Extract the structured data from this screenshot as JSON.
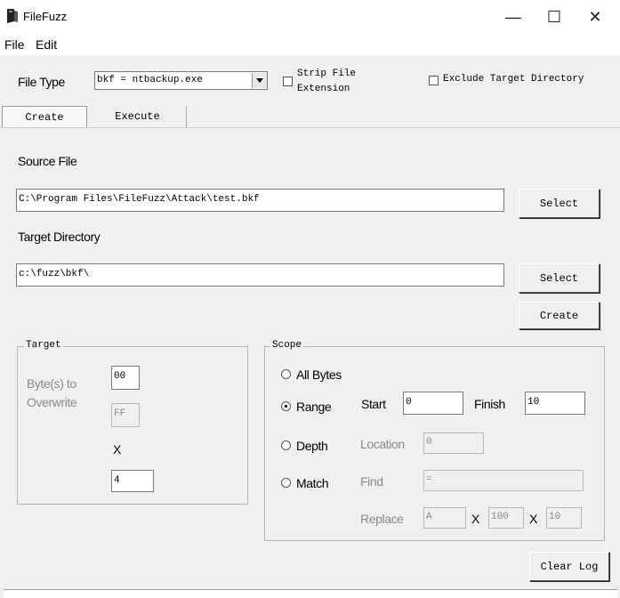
{
  "window": {
    "title": "FileFuzz",
    "minimize": "—",
    "maximize": "☐",
    "close": "✕"
  },
  "menu": {
    "file": "File",
    "edit": "Edit"
  },
  "header": {
    "file_type_label": "File Type",
    "file_type_value": "bkf = ntbackup.exe",
    "strip_ext_line1": "Strip File",
    "strip_ext_line2": "Extension",
    "exclude_target_dir": "Exclude Target Directory"
  },
  "tabs": [
    {
      "label": "Create",
      "active": true
    },
    {
      "label": "Execute",
      "active": false
    }
  ],
  "create": {
    "source_file_label": "Source File",
    "source_file_value": "C:\\Program Files\\FileFuzz\\Attack\\test.bkf",
    "source_select": "Select",
    "target_dir_label": "Target Directory",
    "target_dir_value": "c:\\fuzz\\bkf\\",
    "target_select": "Select",
    "create_button": "Create"
  },
  "target_group": {
    "title": "Target",
    "bytes_label_line1": "Byte(s) to",
    "bytes_label_line2": "Overwrite",
    "bytes_value": "00",
    "ff_value": "FF",
    "x_label": "X",
    "count_value": "4"
  },
  "scope_group": {
    "title": "Scope",
    "all_bytes": "All Bytes",
    "range": "Range",
    "depth": "Depth",
    "match": "Match",
    "start_label": "Start",
    "start_value": "0",
    "finish_label": "Finish",
    "finish_value": "10",
    "location_label": "Location",
    "location_value": "0",
    "find_label": "Find",
    "find_value": "=",
    "replace_label": "Replace",
    "replace_value": "A",
    "x1": "X",
    "replace_count": "100",
    "x2": "X",
    "replace_count2": "10"
  },
  "clear_log": "Clear Log"
}
